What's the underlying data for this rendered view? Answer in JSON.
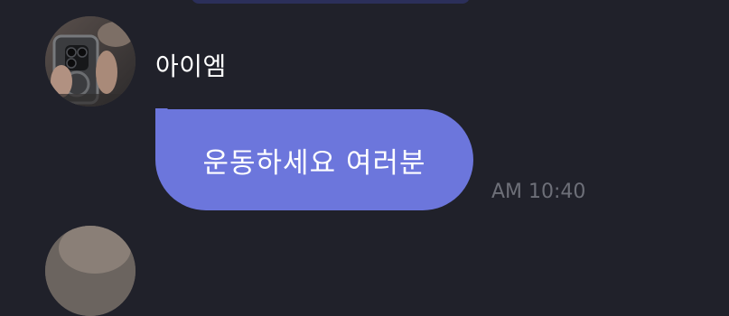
{
  "message": {
    "sender_name": "아이엠",
    "text": "운동하세요 여러분",
    "time": "AM 10:40"
  },
  "colors": {
    "background": "#20212a",
    "bubble": "#6c76dc",
    "timestamp": "#6d6f78",
    "name": "#ffffff"
  },
  "icons": {
    "avatar": "profile-photo",
    "next_avatar": "profile-photo"
  }
}
